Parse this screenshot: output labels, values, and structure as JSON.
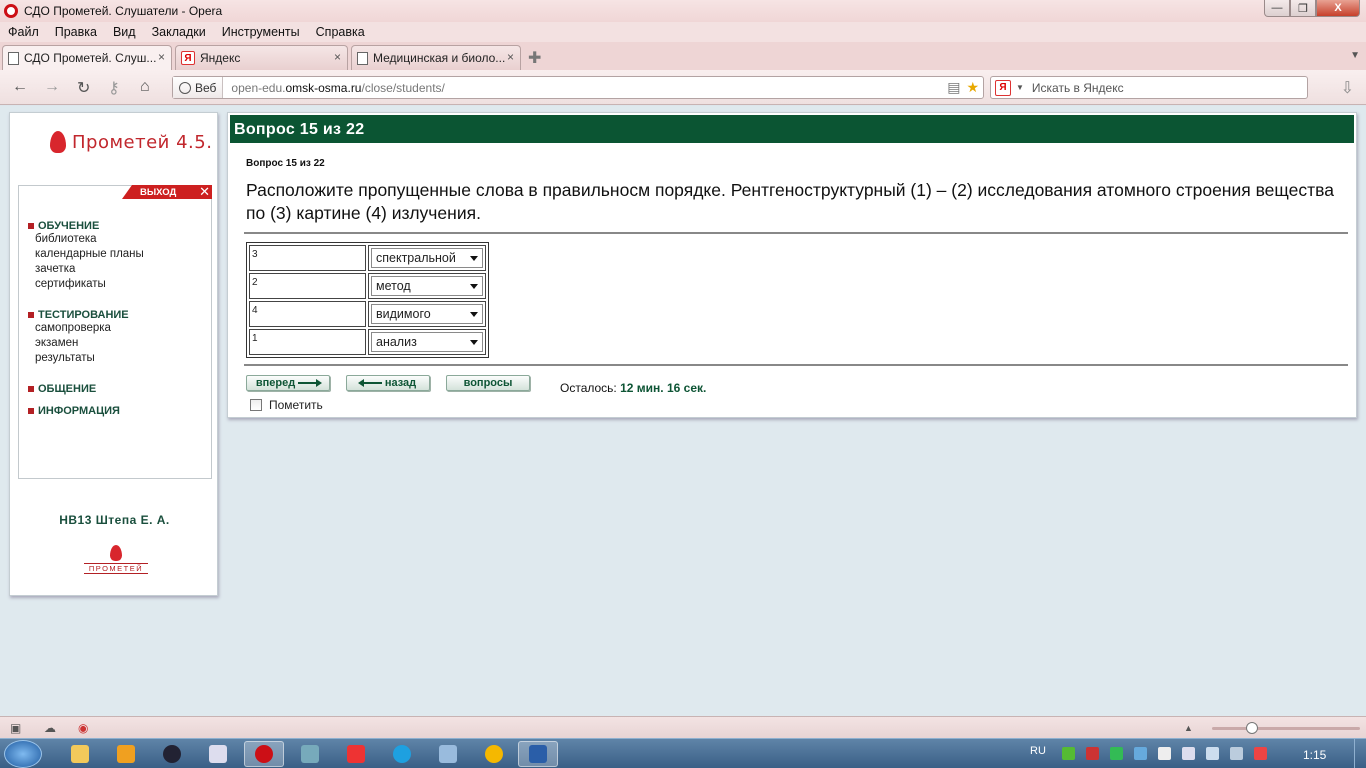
{
  "window": {
    "title": "СДО Прометей. Слушатели - Opera",
    "minimize": "—",
    "maximize": "❐",
    "close": "X"
  },
  "menu": [
    "Файл",
    "Правка",
    "Вид",
    "Закладки",
    "Инструменты",
    "Справка"
  ],
  "tabs": [
    {
      "label": "СДО Прометей. Слуш...",
      "icon": "page-icon",
      "close": "×"
    },
    {
      "label": "Яндекс",
      "icon": "yandex-icon",
      "close": "×"
    },
    {
      "label": "Медицинская и биоло...",
      "icon": "page-icon",
      "close": "×"
    }
  ],
  "toolbar": {
    "back": "←",
    "forward": "→",
    "reload": "↻",
    "key": "⚷",
    "home": "⌂",
    "web_label": "Веб",
    "url_prefix": "open-edu.",
    "url_host": "omsk-osma.ru",
    "url_path": "/close/students/",
    "search_placeholder": "Искать в Яндекс",
    "search_engine": "Я"
  },
  "sidebar": {
    "logo": "Прометей 4.5.",
    "exit": "ВЫХОД",
    "exit_x": "✕",
    "sections": [
      {
        "title": "ОБУЧЕНИЕ",
        "items": [
          "библиотека",
          "календарные планы",
          "зачетка",
          "сертификаты"
        ]
      },
      {
        "title": "ТЕСТИРОВАНИЕ",
        "items": [
          "самопроверка",
          "экзамен",
          "результаты"
        ]
      },
      {
        "title": "ОБЩЕНИЕ",
        "items": []
      },
      {
        "title": "ИНФОРМАЦИЯ",
        "items": []
      }
    ],
    "user": "НВ13 Штепа Е. А.",
    "footer_logo": "ПРОМЕТЕЙ"
  },
  "question": {
    "header": "Вопрос 15 из 22",
    "subheader": "Вопрос 15 из 22",
    "text": "Расположите пропущенные слова в правильносм порядке. Рентгеноструктурный (1) – (2) исследования атомного строения вещества по (3) картине (4) излучения.",
    "rows": [
      {
        "num": "3",
        "value": "спектральной"
      },
      {
        "num": "2",
        "value": "метод"
      },
      {
        "num": "4",
        "value": "видимого"
      },
      {
        "num": "1",
        "value": "анализ"
      }
    ],
    "buttons": {
      "forward": "вперед",
      "back": "назад",
      "questions": "вопросы"
    },
    "remaining_label": "Осталось:",
    "remaining_value": "12 мин. 16 сек.",
    "mark_label": "Пометить"
  },
  "taskbar": {
    "lang": "RU",
    "clock": "1:15"
  },
  "colors": {
    "header_green": "#0b5533",
    "accent_red": "#cd2020",
    "link_green": "#0e5535"
  }
}
